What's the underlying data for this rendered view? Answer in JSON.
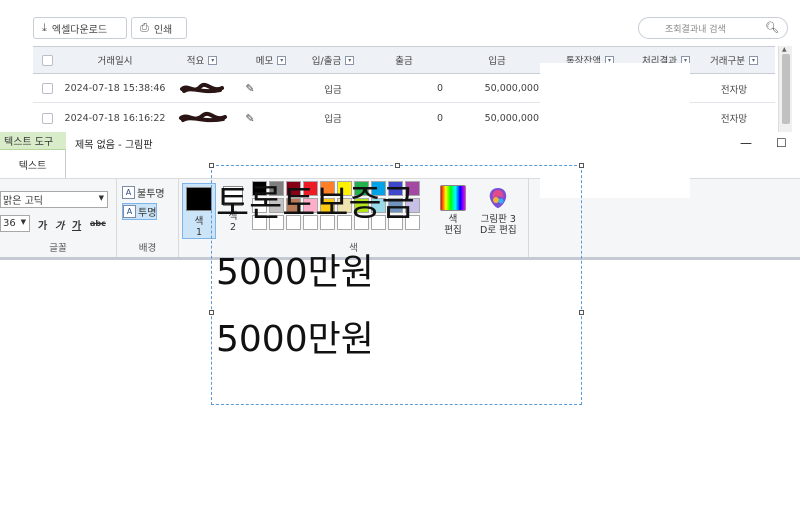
{
  "bank": {
    "excel_download": "엑셀다운로드",
    "print": "인쇄",
    "search_placeholder": "조회결과내 검색",
    "columns": [
      "거래일시",
      "적요",
      "메모",
      "입/출금",
      "출금",
      "입금",
      "통장잔액",
      "처리결과",
      "거래구분"
    ],
    "rows": [
      {
        "datetime": "2024-07-18 15:38:46",
        "type": "입금",
        "withdrawal": "0",
        "deposit": "50,000,000",
        "category": "전자망"
      },
      {
        "datetime": "2024-07-18 16:16:22",
        "type": "입금",
        "withdrawal": "0",
        "deposit": "50,000,000",
        "category": "전자망"
      }
    ]
  },
  "paint": {
    "ctx_tab_head": "텍스트 도구",
    "ctx_tab_sub": "텍스트",
    "window_title": "제목 없음 - 그림판",
    "minimize": "—",
    "maximize": "☐",
    "font_name": "맑은 고딕",
    "font_size": "36",
    "font_group": "글꼴",
    "bg_opaque": "불투명",
    "bg_transparent": "투명",
    "bg_group": "배경",
    "color1_label": "색\n1",
    "color1_a": "색",
    "color1_b": "1",
    "color2_a": "색",
    "color2_b": "2",
    "color_group": "색",
    "edit_colors_a": "색",
    "edit_colors_b": "편집",
    "paint3d_a": "그림판 3",
    "paint3d_b": "D로 편집",
    "color1_value": "#000000",
    "color2_value": "#ffffff",
    "palette": [
      [
        "#000000",
        "#7f7f7f",
        "#880015",
        "#ed1c24",
        "#ff7f27",
        "#fff200",
        "#22b14c",
        "#00a2e8",
        "#3f48cc",
        "#a349a4"
      ],
      [
        "#ffffff",
        "#c3c3c3",
        "#b97a57",
        "#ffaec9",
        "#ffc90e",
        "#efe4b0",
        "#b5e61d",
        "#99d9ea",
        "#7092be",
        "#c8bfe7"
      ],
      [
        "#ffffff",
        "#ffffff",
        "#ffffff",
        "#ffffff",
        "#ffffff",
        "#ffffff",
        "#ffffff",
        "#ffffff",
        "#ffffff",
        "#ffffff"
      ]
    ]
  },
  "canvas_text": {
    "line1": "토론토보증금",
    "line2": "5000만원",
    "line3": "5000만원"
  }
}
